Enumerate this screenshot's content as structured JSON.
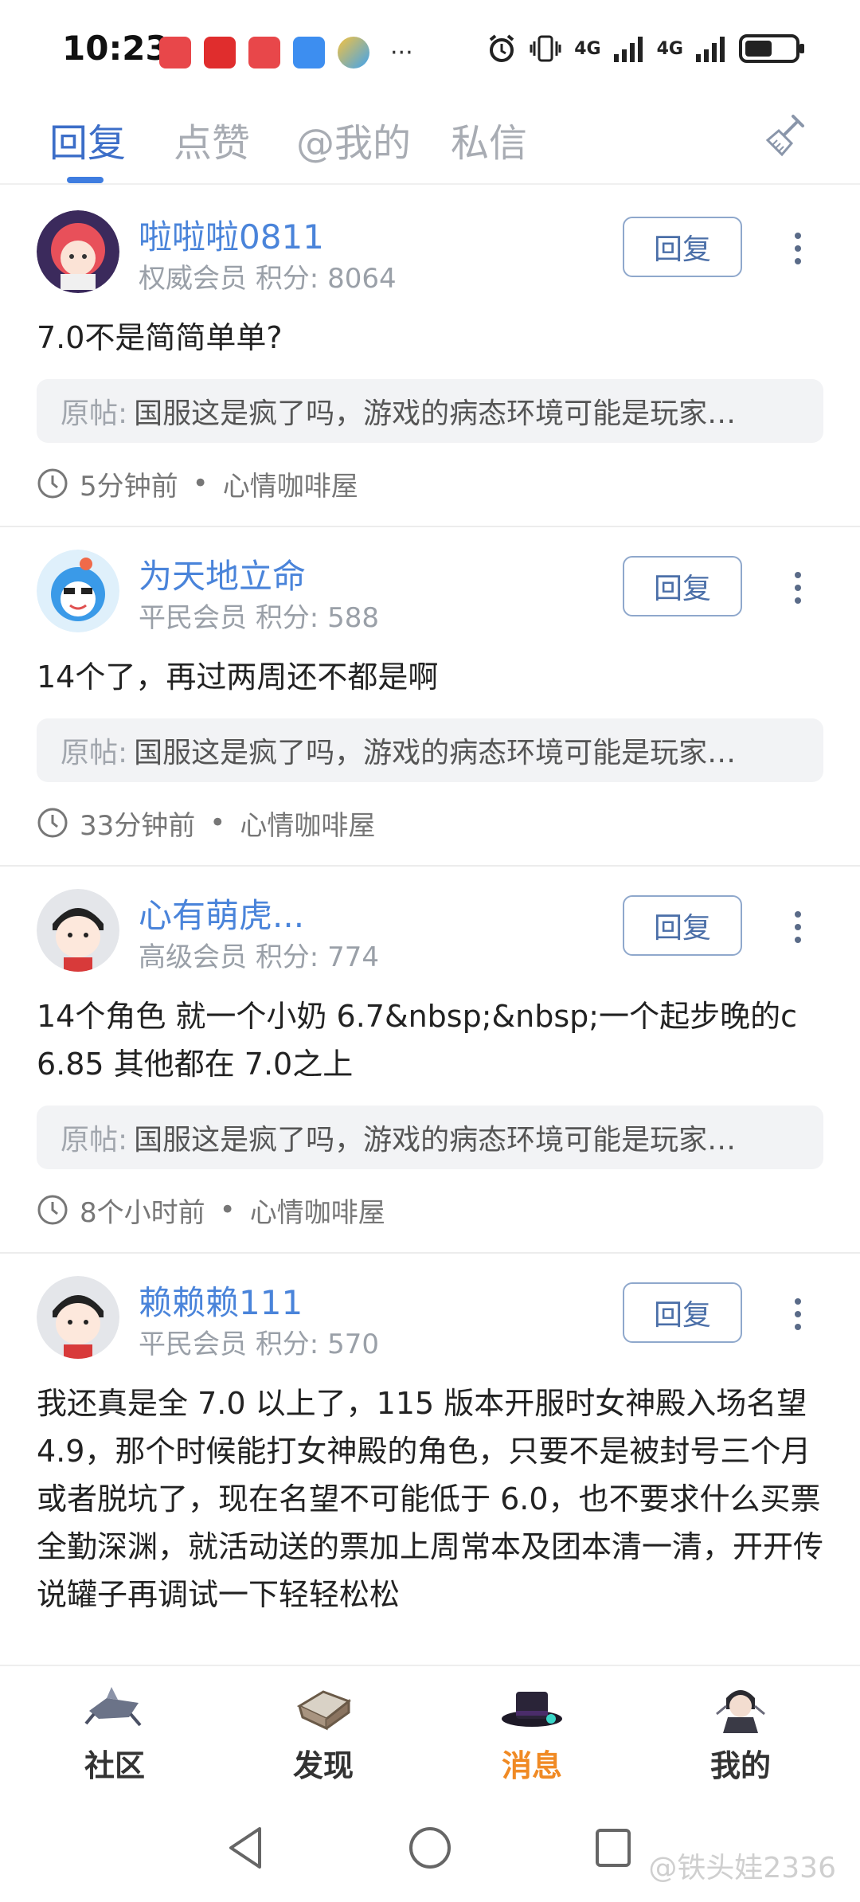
{
  "status_bar": {
    "time": "10:23",
    "network_1": "4G",
    "network_2": "4G",
    "battery_level": 0.55
  },
  "tabs": [
    {
      "label": "回复",
      "active": true
    },
    {
      "label": "点赞",
      "active": false
    },
    {
      "label": "@我的",
      "active": false
    },
    {
      "label": "私信",
      "active": false
    }
  ],
  "reply_button_label": "回复",
  "quote_prefix": "原帖:",
  "posts": [
    {
      "username": "啦啦啦0811",
      "rank": "权威会员",
      "score": "积分: 8064",
      "content": "7.0不是简简单单?",
      "quote": "国服这是疯了吗，游戏的病态环境可能是玩家…",
      "time": "5分钟前",
      "board": "心情咖啡屋"
    },
    {
      "username": "为天地立命",
      "rank": "平民会员",
      "score": "积分: 588",
      "content": "14个了，再过两周还不都是啊",
      "quote": "国服这是疯了吗，游戏的病态环境可能是玩家…",
      "time": "33分钟前",
      "board": "心情咖啡屋"
    },
    {
      "username": "心有萌虎...",
      "rank": "高级会员",
      "score": "积分: 774",
      "content": "14个角色 就一个小奶 6.7&nbsp;&nbsp;一个起步晚的c 6.85 其他都在 7.0之上",
      "quote": "国服这是疯了吗，游戏的病态环境可能是玩家…",
      "time": "8个小时前",
      "board": "心情咖啡屋"
    },
    {
      "username": "赖赖赖111",
      "rank": "平民会员",
      "score": "积分: 570",
      "content": "我还真是全 7.0 以上了，115 版本开服时女神殿入场名望 4.9，那个时候能打女神殿的角色，只要不是被封号三个月或者脱坑了，现在名望不可能低于 6.0，也不要求什么买票全勤深渊，就活动送的票加上周常本及团本清一清，开开传说罐子再调试一下轻轻松松"
    }
  ],
  "bottom_nav": [
    {
      "label": "社区",
      "icon": "community-icon",
      "active": false
    },
    {
      "label": "发现",
      "icon": "discover-icon",
      "active": false
    },
    {
      "label": "消息",
      "icon": "message-hat-icon",
      "active": true
    },
    {
      "label": "我的",
      "icon": "profile-character-icon",
      "active": false
    }
  ],
  "watermark": "@铁头娃2336",
  "colors": {
    "accent": "#3f7de0",
    "username": "#4a84da",
    "active_nav": "#f08a24"
  }
}
